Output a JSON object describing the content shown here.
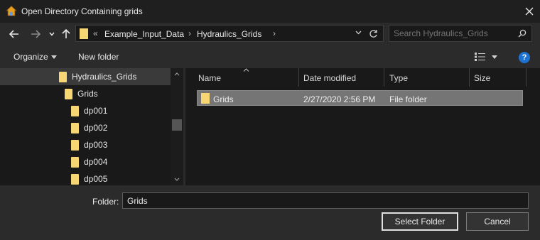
{
  "window": {
    "title": "Open Directory Containing grids"
  },
  "address_bar": {
    "overflow": "«",
    "crumbs": [
      "Example_Input_Data",
      "Hydraulics_Grids"
    ]
  },
  "search": {
    "placeholder": "Search Hydraulics_Grids"
  },
  "toolbar": {
    "organize_label": "Organize",
    "new_folder_label": "New folder"
  },
  "tree": {
    "items": [
      {
        "label": "Hydraulics_Grids"
      },
      {
        "label": "Grids"
      },
      {
        "label": "dp001"
      },
      {
        "label": "dp002"
      },
      {
        "label": "dp003"
      },
      {
        "label": "dp004"
      },
      {
        "label": "dp005"
      }
    ]
  },
  "file_list": {
    "columns": [
      "Name",
      "Date modified",
      "Type",
      "Size"
    ],
    "rows": [
      {
        "name": "Grids",
        "date_modified": "2/27/2020 2:56 PM",
        "type": "File folder",
        "size": ""
      }
    ]
  },
  "footer": {
    "folder_label": "Folder:",
    "folder_value": "Grids",
    "select_button": "Select Folder",
    "cancel_button": "Cancel"
  },
  "colors": {
    "folder": "#f7d774",
    "help": "#1e73d2",
    "background": "#2b2b2b"
  }
}
